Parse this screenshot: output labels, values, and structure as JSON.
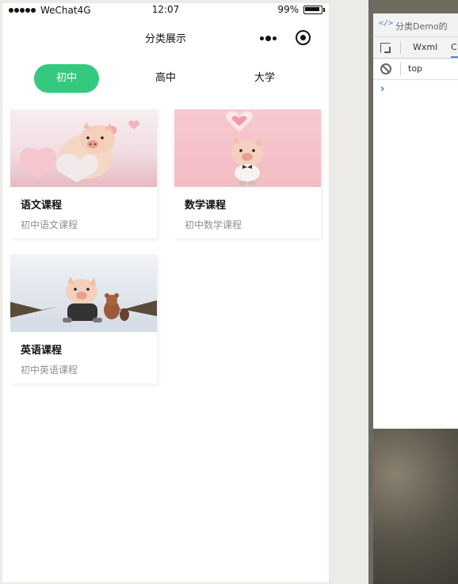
{
  "status_bar": {
    "carrier": "WeChat4G",
    "time": "12:07",
    "battery": "99%"
  },
  "nav": {
    "title": "分类展示",
    "menu_icon": "more-dots-icon",
    "close_icon": "target-close-icon"
  },
  "tabs": [
    {
      "label": "初中",
      "active": true
    },
    {
      "label": "高中",
      "active": false
    },
    {
      "label": "大学",
      "active": false
    }
  ],
  "courses": [
    {
      "title": "语文课程",
      "subtitle": "初中语文课程"
    },
    {
      "title": "数学课程",
      "subtitle": "初中数学课程"
    },
    {
      "title": "英语课程",
      "subtitle": "初中英语课程"
    }
  ],
  "devtools": {
    "title": "分类Demo的",
    "tabs": [
      "Wxml",
      "C"
    ],
    "context": "top",
    "prompt": "›"
  },
  "colors": {
    "accent": "#35c97f",
    "subtitle": "#8f8f8f"
  }
}
